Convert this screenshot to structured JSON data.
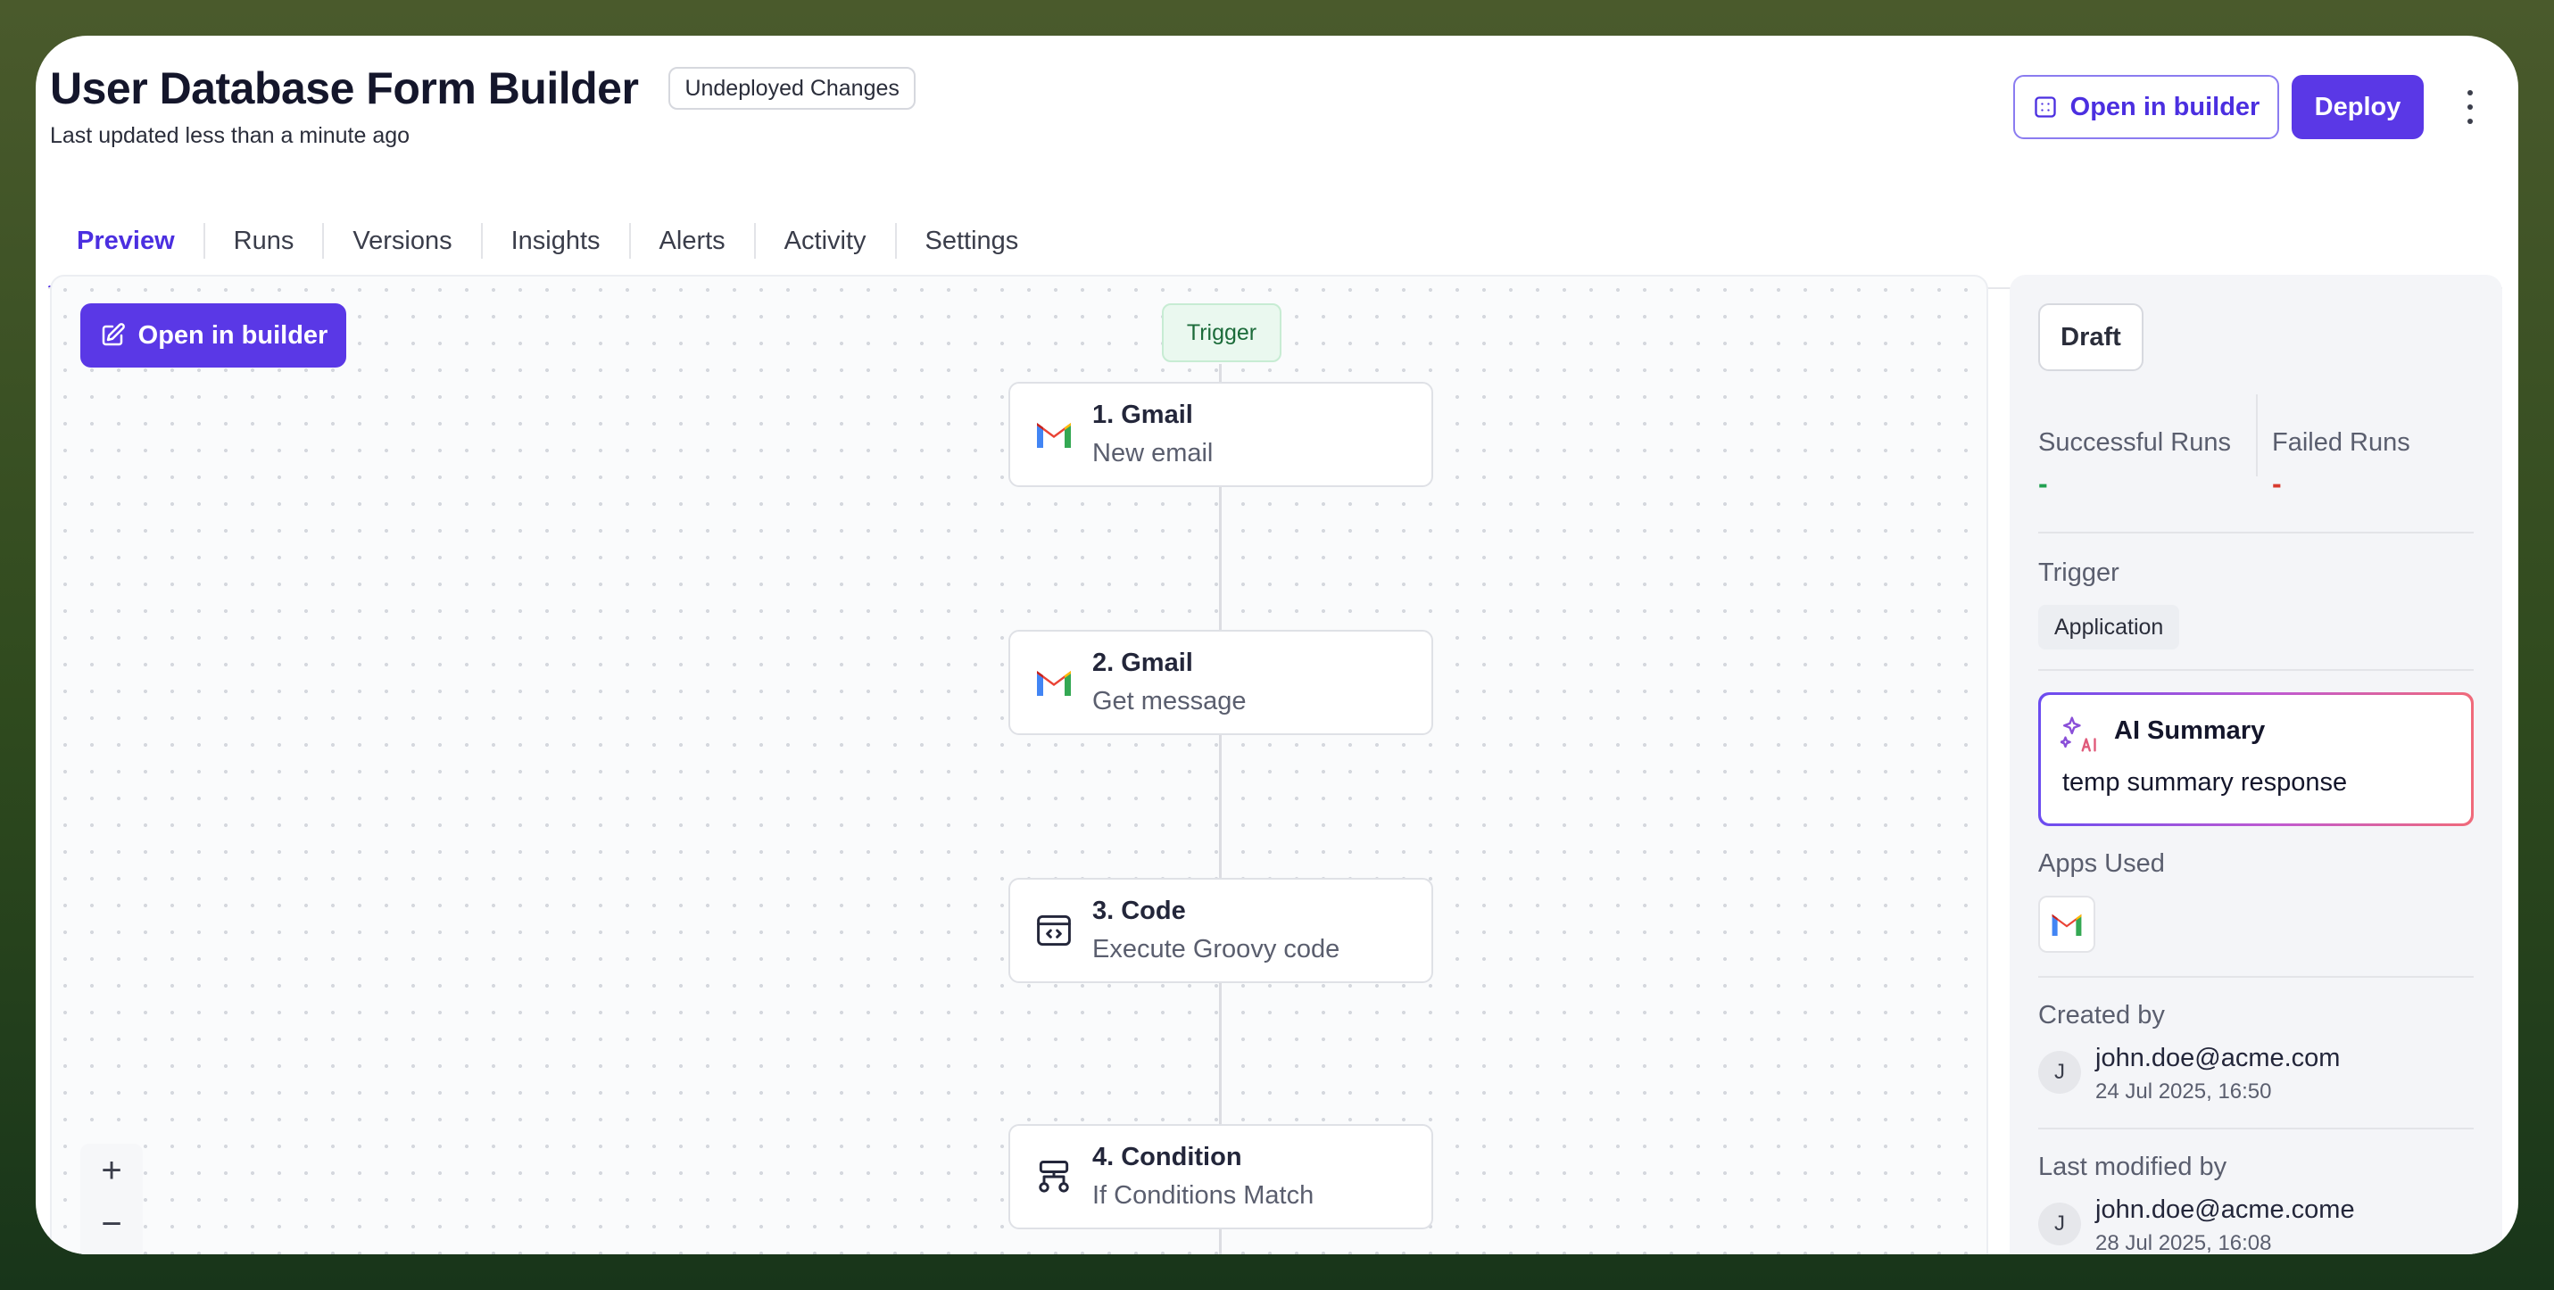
{
  "header": {
    "title": "User Database Form Builder",
    "badge": "Undeployed Changes",
    "subtitle": "Last updated less than a minute ago",
    "open_builder_label": "Open in builder",
    "deploy_label": "Deploy"
  },
  "tabs": [
    {
      "label": "Preview",
      "active": true
    },
    {
      "label": "Runs"
    },
    {
      "label": "Versions"
    },
    {
      "label": "Insights"
    },
    {
      "label": "Alerts"
    },
    {
      "label": "Activity"
    },
    {
      "label": "Settings"
    }
  ],
  "canvas": {
    "open_builder_label": "Open in builder",
    "trigger_label": "Trigger",
    "nodes": [
      {
        "title": "1. Gmail",
        "subtitle": "New email",
        "icon": "gmail-icon"
      },
      {
        "title": "2. Gmail",
        "subtitle": "Get message",
        "icon": "gmail-icon"
      },
      {
        "title": "3. Code",
        "subtitle": "Execute Groovy code",
        "icon": "code-icon"
      },
      {
        "title": "4. Condition",
        "subtitle": "If Conditions Match",
        "icon": "condition-icon"
      }
    ],
    "zoom_in": "+",
    "zoom_out": "−"
  },
  "panel": {
    "status": "Draft",
    "successful_runs_label": "Successful Runs",
    "successful_runs_value": "-",
    "failed_runs_label": "Failed Runs",
    "failed_runs_value": "-",
    "trigger_label": "Trigger",
    "trigger_value": "Application",
    "ai_summary_title": "AI Summary",
    "ai_summary_text": "temp summary response",
    "apps_used_label": "Apps Used",
    "created_by_label": "Created by",
    "created_by_initial": "J",
    "created_by_email": "john.doe@acme.com",
    "created_at": "24 Jul 2025, 16:50",
    "modified_by_label": "Last modified by",
    "modified_by_initial": "J",
    "modified_by_email": "john.doe@acme.come",
    "modified_at": "28 Jul 2025, 16:08"
  },
  "colors": {
    "accent": "#5a38e6",
    "success": "#20a050",
    "danger": "#d83a2e"
  }
}
